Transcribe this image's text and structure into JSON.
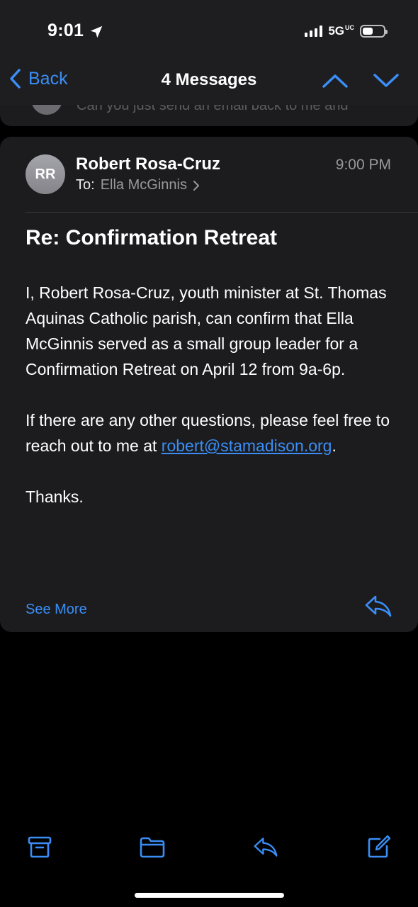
{
  "status": {
    "time": "9:01",
    "network": "5G",
    "network_badge": "UC"
  },
  "nav": {
    "back_label": "Back",
    "title": "4 Messages"
  },
  "previous_message": {
    "preview": "Can you just send an email back to me and"
  },
  "message": {
    "avatar_initials": "RR",
    "sender": "Robert Rosa-Cruz",
    "time": "9:00 PM",
    "to_prefix": "To:",
    "to_name": "Ella McGinnis",
    "subject": "Re: Confirmation Retreat",
    "paragraph1": "I, Robert Rosa-Cruz, youth minister at St. Thomas Aquinas Catholic parish, can confirm that Ella McGinnis served as a small group leader for a Confirmation Retreat on April 12 from 9a-6p.",
    "paragraph2_text": "If there are any other questions, please feel free to reach out to me at ",
    "paragraph2_link": "robert@stamadison.org",
    "paragraph2_end": ".",
    "paragraph3": "Thanks.",
    "see_more": "See More"
  },
  "toolbar": {
    "icons": [
      "archive-icon",
      "folder-icon",
      "reply-icon",
      "compose-icon"
    ]
  },
  "colors": {
    "accent": "#3a8ef6",
    "card": "#1c1c1e",
    "header": "#1e1e20",
    "secondary_text": "#98989e"
  }
}
